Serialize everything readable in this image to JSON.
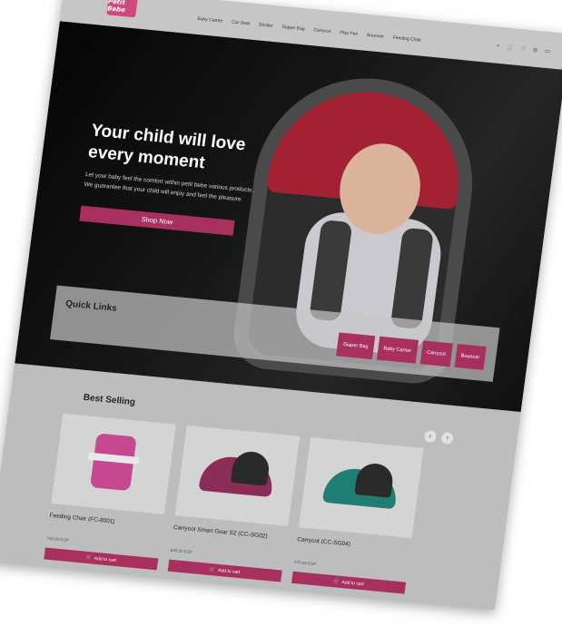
{
  "header": {
    "logo_text": "Petit Bebe",
    "nav": [
      "Baby Carrier",
      "Car Seat",
      "Stroller",
      "Diaper Bag",
      "Carrycot",
      "Play Pen",
      "Bouncer",
      "Feeding Chair"
    ],
    "icons": [
      "search-icon",
      "cart-icon",
      "heart-icon",
      "user-icon",
      "flag-icon"
    ]
  },
  "hero": {
    "title": "Your child will love every moment",
    "text": "Let your baby feel the comfort within petit bebe various products. We guarantee that your child will enjoy and feel the pleasure.",
    "button": "Shop Now"
  },
  "quick_links": {
    "title": "Quick Links",
    "buttons": [
      "Diaper Bag",
      "Baby Carrier",
      "Carrycot",
      "Bouncer"
    ]
  },
  "best_selling": {
    "title": "Best Selling",
    "prev": "‹",
    "next": "›",
    "products": [
      {
        "name": "Feeding Chair (FC-8001)",
        "price": "740.00 EGP",
        "cart": "Add to cart"
      },
      {
        "name": "Carrycot Smart Gear S2 (CC-SG02)",
        "price": "845.00 EGP",
        "cart": "Add to cart"
      },
      {
        "name": "Carrycot (CC-SG04)",
        "price": "570.00 EGP",
        "cart": "Add to cart"
      }
    ]
  },
  "colors": {
    "accent": "#a8305f",
    "overlay": "#bdbdbd",
    "hero_bg": "#111111"
  }
}
